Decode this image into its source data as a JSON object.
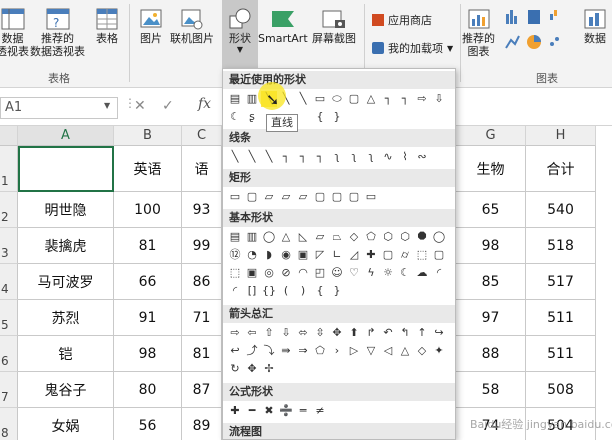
{
  "ribbon": {
    "buttons": {
      "pivot": "数据\n透视表",
      "recommended_pivot": "推荐的\n数据透视表",
      "table": "表格",
      "picture": "图片",
      "online_picture": "联机图片",
      "shapes": "形状",
      "smartart": "SmartArt",
      "screenshot": "屏幕截图",
      "store": "应用商店",
      "my_addins": "我的加载项",
      "recommended_charts": "推荐的\n图表",
      "pivot_chart": "数据"
    },
    "groups": {
      "tables": "表格",
      "charts": "图表"
    }
  },
  "formula_bar": {
    "name_box": "A1",
    "fx": "fx"
  },
  "columns": [
    "A",
    "B",
    "C",
    "G",
    "H"
  ],
  "rows": [
    "1",
    "2",
    "3",
    "4",
    "5",
    "6",
    "7",
    "8"
  ],
  "table": {
    "header": [
      "",
      "英语",
      "语",
      "生物",
      "合计"
    ],
    "rows": [
      [
        "明世隐",
        "100",
        "93",
        "65",
        "540"
      ],
      [
        "裴擒虎",
        "81",
        "99",
        "98",
        "518"
      ],
      [
        "马可波罗",
        "66",
        "86",
        "85",
        "517"
      ],
      [
        "苏烈",
        "91",
        "71",
        "97",
        "511"
      ],
      [
        "铠",
        "98",
        "81",
        "88",
        "511"
      ],
      [
        "鬼谷子",
        "80",
        "87",
        "58",
        "508"
      ],
      [
        "女娲",
        "56",
        "89",
        "74",
        "504"
      ]
    ]
  },
  "shape_menu": {
    "sections": {
      "recent": "最近使用的形状",
      "lines": "线条",
      "rect": "矩形",
      "basic": "基本形状",
      "arrows": "箭头总汇",
      "equation": "公式形状",
      "flowchart": "流程图"
    },
    "tooltip": "直线"
  },
  "watermark": "Baidu经验 jingyan.baidu.com"
}
